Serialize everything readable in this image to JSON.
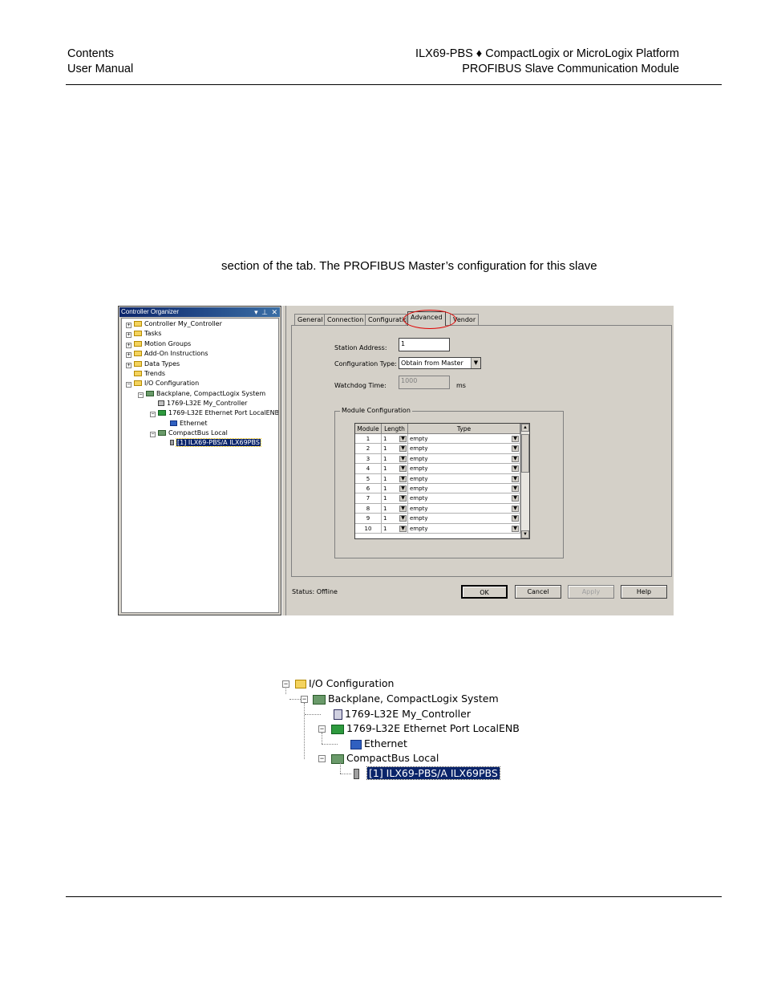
{
  "header": {
    "left_line1": "Contents",
    "left_line2": "User Manual",
    "right_line1": "ILX69-PBS ♦ CompactLogix or MicroLogix Platform",
    "right_line2": "PROFIBUS Slave Communication Module"
  },
  "body": {
    "partial_line": "section of the tab. The PROFIBUS Master’s configuration for this slave"
  },
  "organizer": {
    "title": "Controller Organizer",
    "title_buttons": "▾ ⊥ ✕",
    "items": [
      {
        "label": "Controller My_Controller"
      },
      {
        "label": "Tasks"
      },
      {
        "label": "Motion Groups"
      },
      {
        "label": "Add-On Instructions"
      },
      {
        "label": "Data Types"
      },
      {
        "label": "Trends"
      },
      {
        "label": "I/O Configuration"
      },
      {
        "label": "Backplane, CompactLogix System"
      },
      {
        "label": "1769-L32E My_Controller"
      },
      {
        "label": "1769-L32E Ethernet Port LocalENB"
      },
      {
        "label": "Ethernet"
      },
      {
        "label": "CompactBus Local"
      },
      {
        "label": "[1] ILX69-PBS/A ILX69PBS"
      }
    ]
  },
  "dialog": {
    "tabs": [
      "General",
      "Connection",
      "Configuration",
      "Advanced",
      "Vendor"
    ],
    "active_tab": "Advanced",
    "station_address_label": "Station Address:",
    "station_address_value": "1",
    "config_type_label": "Configuration Type:",
    "config_type_value": "Obtain from Master",
    "watchdog_label": "Watchdog Time:",
    "watchdog_value": "1000",
    "watchdog_unit": "ms",
    "module_config_title": "Module Configuration",
    "grid_headers": [
      "Module",
      "Length",
      "Type"
    ],
    "grid_rows": [
      {
        "module": "1",
        "length": "1",
        "type": "empty"
      },
      {
        "module": "2",
        "length": "1",
        "type": "empty"
      },
      {
        "module": "3",
        "length": "1",
        "type": "empty"
      },
      {
        "module": "4",
        "length": "1",
        "type": "empty"
      },
      {
        "module": "5",
        "length": "1",
        "type": "empty"
      },
      {
        "module": "6",
        "length": "1",
        "type": "empty"
      },
      {
        "module": "7",
        "length": "1",
        "type": "empty"
      },
      {
        "module": "8",
        "length": "1",
        "type": "empty"
      },
      {
        "module": "9",
        "length": "1",
        "type": "empty"
      },
      {
        "module": "10",
        "length": "1",
        "type": "empty"
      }
    ],
    "status_label": "Status:",
    "status_value": "Offline",
    "buttons": {
      "ok": "OK",
      "cancel": "Cancel",
      "apply": "Apply",
      "help": "Help"
    },
    "highlight_color": "#e00000"
  },
  "tree2": {
    "items": [
      {
        "label": "I/O Configuration"
      },
      {
        "label": "Backplane, CompactLogix System"
      },
      {
        "label": "1769-L32E My_Controller"
      },
      {
        "label": "1769-L32E Ethernet Port LocalENB"
      },
      {
        "label": "Ethernet"
      },
      {
        "label": "CompactBus Local"
      },
      {
        "label": "[1] ILX69-PBS/A ILX69PBS"
      }
    ]
  }
}
